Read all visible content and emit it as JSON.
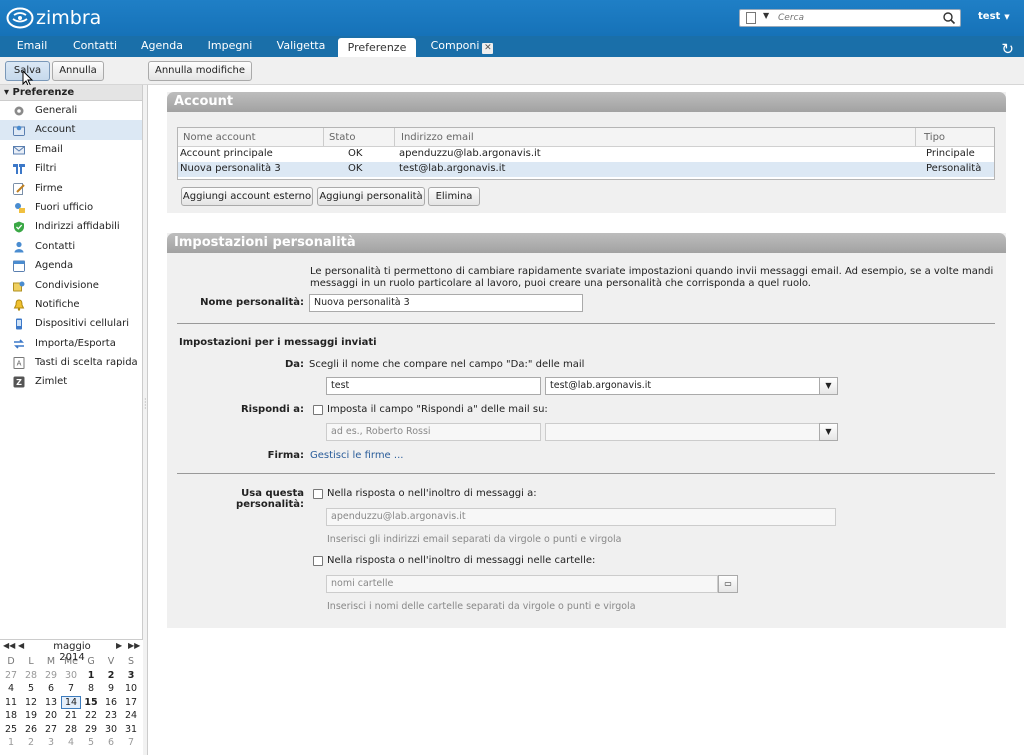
{
  "header": {
    "logo_text": "zimbra",
    "search_placeholder": "Cerca",
    "user": "test"
  },
  "tabs": [
    {
      "label": "Email"
    },
    {
      "label": "Contatti"
    },
    {
      "label": "Agenda"
    },
    {
      "label": "Impegni"
    },
    {
      "label": "Valigetta"
    },
    {
      "label": "Preferenze"
    },
    {
      "label": "Componi"
    }
  ],
  "toolbar": {
    "save_label": "Salva",
    "cancel_label": "Annulla",
    "undo_label": "Annulla modifiche"
  },
  "sidebar": {
    "title": "Preferenze",
    "items": [
      {
        "label": "Generali",
        "icon": "gear-icon"
      },
      {
        "label": "Account",
        "icon": "account-icon"
      },
      {
        "label": "Email",
        "icon": "mail-icon"
      },
      {
        "label": "Filtri",
        "icon": "filter-icon"
      },
      {
        "label": "Firme",
        "icon": "signature-icon"
      },
      {
        "label": "Fuori ufficio",
        "icon": "out-of-office-icon"
      },
      {
        "label": "Indirizzi affidabili",
        "icon": "shield-icon"
      },
      {
        "label": "Contatti",
        "icon": "contact-icon"
      },
      {
        "label": "Agenda",
        "icon": "calendar-icon"
      },
      {
        "label": "Condivisione",
        "icon": "share-icon"
      },
      {
        "label": "Notifiche",
        "icon": "bell-icon"
      },
      {
        "label": "Dispositivi cellulari",
        "icon": "mobile-icon"
      },
      {
        "label": "Importa/Esporta",
        "icon": "import-export-icon"
      },
      {
        "label": "Tasti di scelta rapida",
        "icon": "keyboard-icon"
      },
      {
        "label": "Zimlet",
        "icon": "zimlet-icon"
      }
    ]
  },
  "calendar": {
    "month": "maggio 2014",
    "day_names": [
      "D",
      "L",
      "M",
      "Me",
      "G",
      "V",
      "S"
    ],
    "weeks": [
      [
        "27",
        "28",
        "29",
        "30",
        "1",
        "2",
        "3"
      ],
      [
        "4",
        "5",
        "6",
        "7",
        "8",
        "9",
        "10"
      ],
      [
        "11",
        "12",
        "13",
        "14",
        "15",
        "16",
        "17"
      ],
      [
        "18",
        "19",
        "20",
        "21",
        "22",
        "23",
        "24"
      ],
      [
        "25",
        "26",
        "27",
        "28",
        "29",
        "30",
        "31"
      ],
      [
        "1",
        "2",
        "3",
        "4",
        "5",
        "6",
        "7"
      ]
    ],
    "today": "14",
    "bold_day": "15"
  },
  "account_panel": {
    "title": "Account",
    "columns": [
      "Nome account",
      "Stato",
      "Indirizzo email",
      "Tipo"
    ],
    "rows": [
      {
        "name": "Account principale",
        "status": "OK",
        "email": "apenduzzu@lab.argonavis.it",
        "type": "Principale"
      },
      {
        "name": "Nuova personalità 3",
        "status": "OK",
        "email": "test@lab.argonavis.it",
        "type": "Personalità"
      }
    ],
    "btn_add_external": "Aggiungi account esterno",
    "btn_add_persona": "Aggiungi personalità",
    "btn_delete": "Elimina"
  },
  "persona_panel": {
    "title": "Impostazioni personalità",
    "intro": "Le personalità ti permettono di cambiare rapidamente svariate impostazioni quando invii messaggi email. Ad esempio, se a volte mandi messaggi in un ruolo particolare al lavoro, puoi creare una personalità che corrisponda a quel ruolo.",
    "name_label": "Nome personalità:",
    "name_value": "Nuova personalità 3",
    "sent_section": "Impostazioni per i messaggi inviati",
    "from_label": "Da:",
    "from_hint": "Scegli il nome che compare nel campo \"Da:\" delle mail",
    "from_name": "test",
    "from_address": "test@lab.argonavis.it",
    "reply_label": "Rispondi a:",
    "reply_checkbox": "Imposta il campo \"Rispondi a\" delle mail su:",
    "reply_placeholder": "ad es., Roberto Rossi",
    "signature_label": "Firma:",
    "signature_link": "Gestisci le firme ...",
    "use_label": "Usa questa personalità:",
    "use_reply_checkbox": "Nella risposta o nell'inoltro di messaggi a:",
    "use_reply_placeholder": "apenduzzu@lab.argonavis.it",
    "use_reply_hint": "Inserisci gli indirizzi email separati da virgole o punti e virgola",
    "use_folder_checkbox": "Nella risposta o nell'inoltro di messaggi nelle cartelle:",
    "folder_placeholder": "nomi cartelle",
    "folder_hint": "Inserisci i nomi delle cartelle separati da virgole o punti e virgola"
  },
  "colors": {
    "header_blue": "#1f7fc6",
    "tabbar_blue": "#1a6fa9",
    "selection": "#dce8f4",
    "panel_header": "#a9a9a9",
    "link": "#2a5d9a"
  }
}
